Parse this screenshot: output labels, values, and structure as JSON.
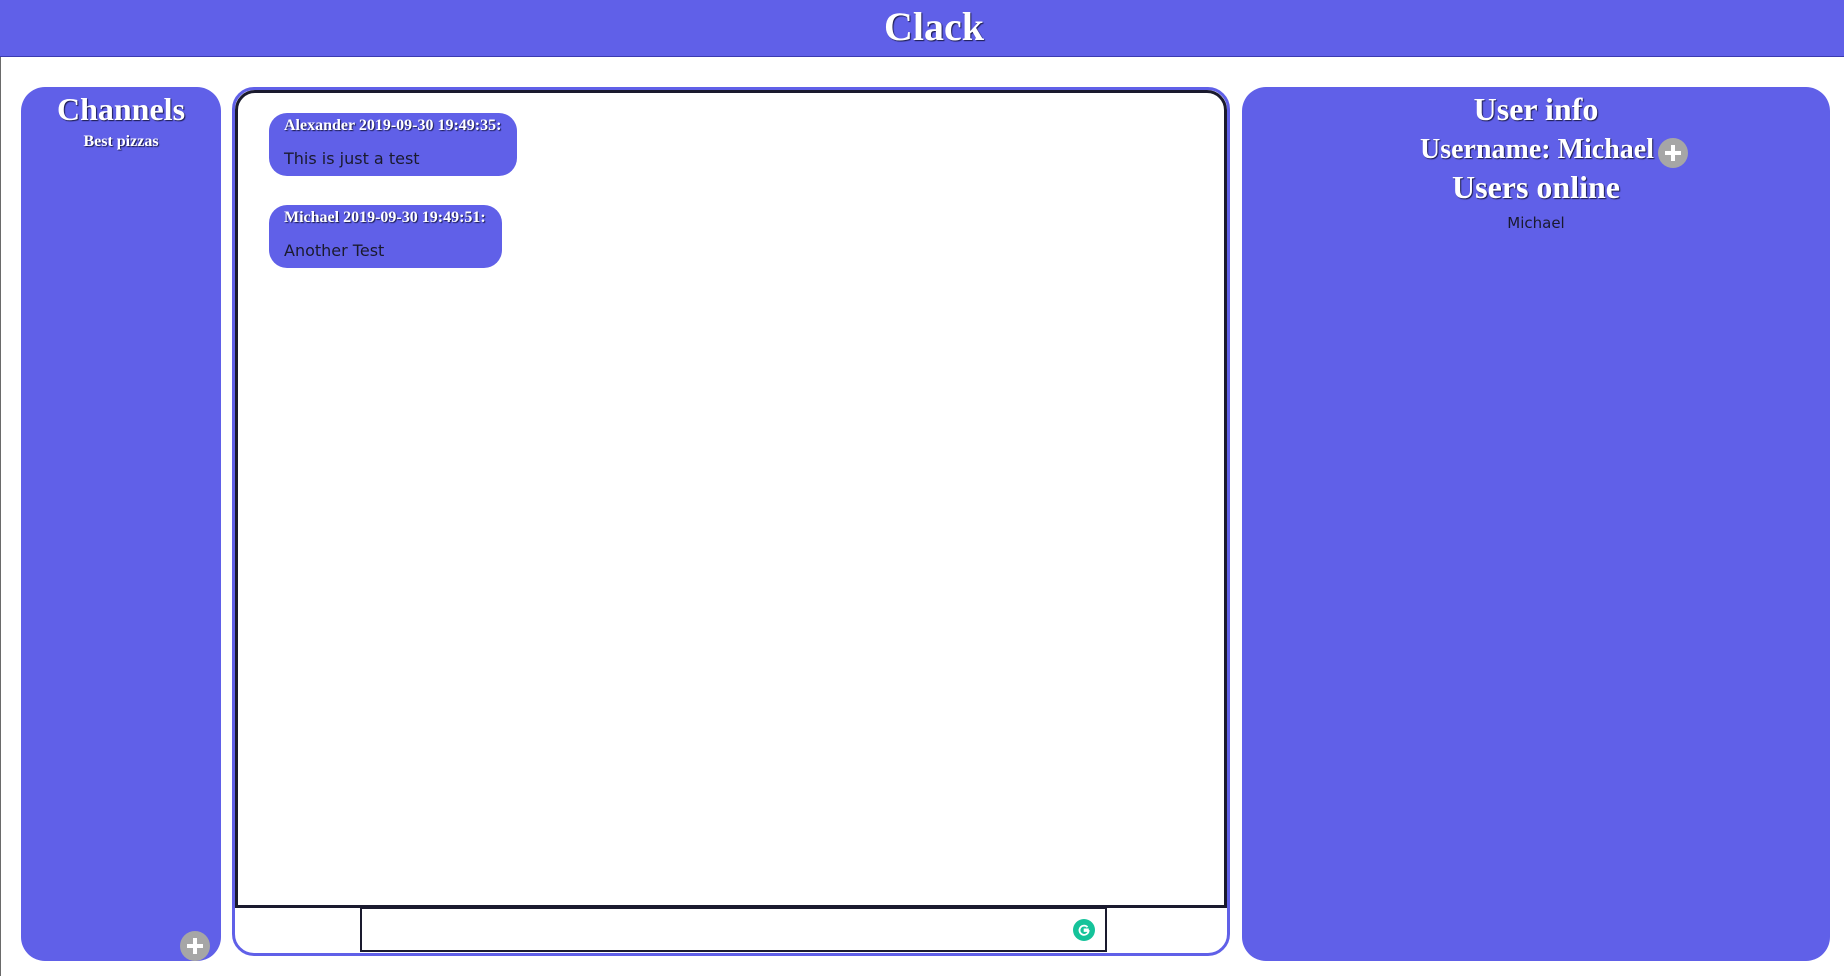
{
  "app": {
    "title": "Clack"
  },
  "channels": {
    "heading": "Channels",
    "items": [
      {
        "label": "Best pizzas"
      }
    ],
    "add_icon": "plus-icon"
  },
  "chat": {
    "messages": [
      {
        "author": "Alexander",
        "timestamp": "2019-09-30 19:49:35:",
        "header": "Alexander 2019-09-30 19:49:35:",
        "text": "This is just a test"
      },
      {
        "author": "Michael",
        "timestamp": "2019-09-30 19:49:51:",
        "header": "Michael 2019-09-30 19:49:51:",
        "text": "Another Test"
      }
    ],
    "input": {
      "value": "",
      "placeholder": ""
    }
  },
  "user_info": {
    "heading": "User info",
    "username_label": "Username: Michael",
    "edit_icon": "plus-icon",
    "users_online_heading": "Users online",
    "online_users": [
      "Michael"
    ]
  },
  "colors": {
    "accent": "#6060e8",
    "text_dark": "#1a1a2e",
    "button_gray": "#a6a6a6",
    "grammarly": "#15c39a"
  }
}
